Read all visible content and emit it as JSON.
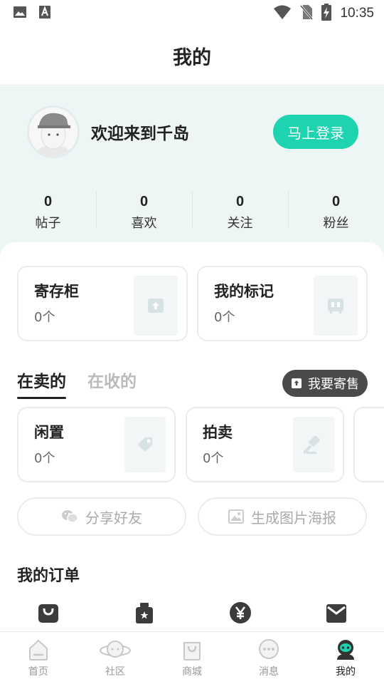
{
  "status_bar": {
    "time": "10:35",
    "left_icons": [
      "image-icon",
      "text-a-icon"
    ],
    "right_icons": [
      "wifi-icon",
      "no-sim-icon",
      "battery-charging-icon"
    ]
  },
  "header": {
    "title": "我的"
  },
  "profile": {
    "welcome": "欢迎来到千岛",
    "login_label": "马上登录",
    "accent_color": "#1dd3b0"
  },
  "stats": [
    {
      "value": "0",
      "label": "帖子"
    },
    {
      "value": "0",
      "label": "喜欢"
    },
    {
      "value": "0",
      "label": "关注"
    },
    {
      "value": "0",
      "label": "粉丝"
    }
  ],
  "storage_cards": [
    {
      "title": "寄存柜",
      "count": "0个",
      "icon": "locker-icon"
    },
    {
      "title": "我的标记",
      "count": "0个",
      "icon": "mark-icon"
    }
  ],
  "tabs": [
    {
      "label": "在卖的",
      "active": true
    },
    {
      "label": "在收的",
      "active": false
    }
  ],
  "consign_label": "我要寄售",
  "sale_cards": [
    {
      "title": "闲置",
      "count": "0个",
      "icon": "tag-icon"
    },
    {
      "title": "拍卖",
      "count": "0个",
      "icon": "gavel-icon"
    }
  ],
  "share_buttons": {
    "share_friends": "分享好友",
    "generate_poster": "生成图片海报"
  },
  "orders": {
    "title": "我的订单",
    "icons": [
      "bag-icon",
      "package-icon",
      "yen-icon",
      "envelope-icon"
    ]
  },
  "bottom_nav": [
    {
      "label": "首页",
      "icon": "home-icon",
      "active": false
    },
    {
      "label": "社区",
      "icon": "planet-icon",
      "active": false
    },
    {
      "label": "商城",
      "icon": "shop-bag-icon",
      "active": false
    },
    {
      "label": "消息",
      "icon": "message-icon",
      "active": false
    },
    {
      "label": "我的",
      "icon": "profile-icon",
      "active": true
    }
  ]
}
